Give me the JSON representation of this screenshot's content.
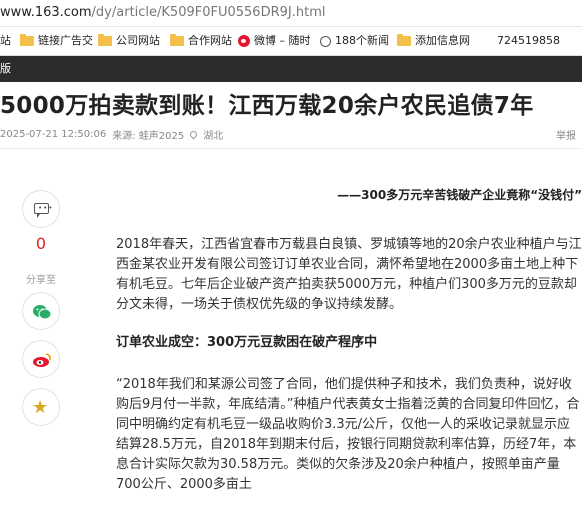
{
  "browser": {
    "url_host": "www.163.com",
    "url_path": "/dy/article/K509F0FU0556DR9J.html"
  },
  "bookmarks": [
    {
      "label": "站",
      "icon": "folder-icon"
    },
    {
      "label": "链接广告交",
      "icon": "folder-icon"
    },
    {
      "label": "公司网站",
      "icon": "folder-icon"
    },
    {
      "label": "合作网站",
      "icon": "folder-icon"
    },
    {
      "label": "微博 – 随时",
      "icon": "weibo-icon"
    },
    {
      "label": "188个新闻",
      "icon": "globe-icon"
    },
    {
      "label": "添加信息网",
      "icon": "folder-icon"
    },
    {
      "label": "724519858",
      "icon": ""
    }
  ],
  "nav_strip": {
    "label": "版"
  },
  "article": {
    "title": "5000万拍卖款到账！江西万载20余户农民追债7年",
    "date": "2025-07-21 12:50:06",
    "source": "来源: 蛙声2025",
    "location": "湖北",
    "report": "举报",
    "subtitle": "——300多万元辛苦钱破产企业竟称“没钱付”",
    "paragraphs": [
      "2018年春天，江西省宜春市万载县白良镇、罗城镇等地的20余户农业种植户与江西金某农业开发有限公司签订订单农业合同，满怀希望地在2000多亩土地上种下有机毛豆。七年后企业破产资产拍卖获5000万元，种植户们300多万元的豆款却分文未得，一场关于债权优先级的争议持续发酵。",
      "订单农业成空：300万元豆款困在破产程序中",
      "“2018年我们和某源公司签了合同，他们提供种子和技术，我们负责种，说好收购后9月付一半款，年底结清。”种植户代表黄女士指着泛黄的合同复印件回忆，合同中明确约定有机毛豆一级品收购价3.3元/公斤，仅他一人的采收记录就显示应结算28.5万元，自2018年到期末付后，按银行同期贷款利率估算，历经7年，本息合计实际欠款为30.58万元。类似的欠条涉及20余户种植户，按照单亩产量700公斤、2000多亩土"
    ]
  },
  "sidebar": {
    "comment_count": "0",
    "share_label": "分享至"
  },
  "colors": {
    "accent_red": "#e0251b",
    "nav_dark": "#2c2c2c",
    "wechat_green": "#2aae67",
    "weibo_red": "#e6162d",
    "favorite_gold": "#d9a820"
  }
}
